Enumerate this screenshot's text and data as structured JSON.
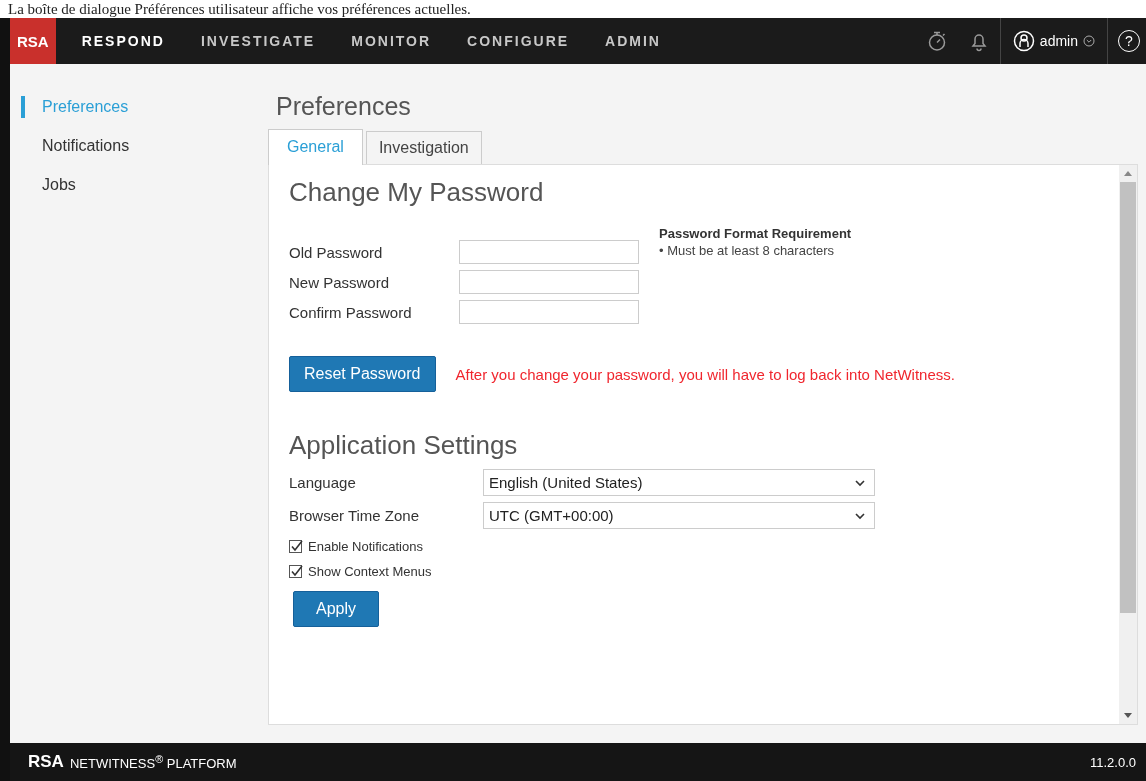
{
  "caption": "La boîte de dialogue Préférences utilisateur affiche vos préférences actuelles.",
  "nav": {
    "logo": "RSA",
    "items": [
      {
        "label": "RESPOND",
        "selected": true
      },
      {
        "label": "INVESTIGATE",
        "selected": false
      },
      {
        "label": "MONITOR",
        "selected": false
      },
      {
        "label": "CONFIGURE",
        "selected": false
      },
      {
        "label": "ADMIN",
        "selected": false
      }
    ],
    "user": "admin",
    "help": "?"
  },
  "sidebar": {
    "items": [
      {
        "label": "Preferences",
        "selected": true
      },
      {
        "label": "Notifications",
        "selected": false
      },
      {
        "label": "Jobs",
        "selected": false
      }
    ]
  },
  "page_title": "Preferences",
  "tabs": [
    {
      "label": "General",
      "selected": true
    },
    {
      "label": "Investigation",
      "selected": false
    }
  ],
  "password": {
    "heading": "Change My Password",
    "fields": [
      {
        "label": "Old Password"
      },
      {
        "label": "New Password"
      },
      {
        "label": "Confirm Password"
      }
    ],
    "requirement": {
      "title": "Password Format Requirement",
      "rules": [
        "• Must be at least 8 characters"
      ]
    },
    "button": "Reset Password",
    "warning": "After you change your password, you will have to log back into NetWitness."
  },
  "settings": {
    "heading": "Application Settings",
    "selects": [
      {
        "label": "Language",
        "value": "English (United States)"
      },
      {
        "label": "Browser Time Zone",
        "value": "UTC (GMT+00:00)"
      }
    ],
    "checkboxes": [
      {
        "label": "Enable Notifications",
        "checked": true
      },
      {
        "label": "Show Context Menus",
        "checked": true
      }
    ],
    "button": "Apply"
  },
  "footer": {
    "logo": "RSA",
    "product": "NETWITNESS$^{®}$ PLATFORM",
    "version": "11.2.0.0"
  }
}
